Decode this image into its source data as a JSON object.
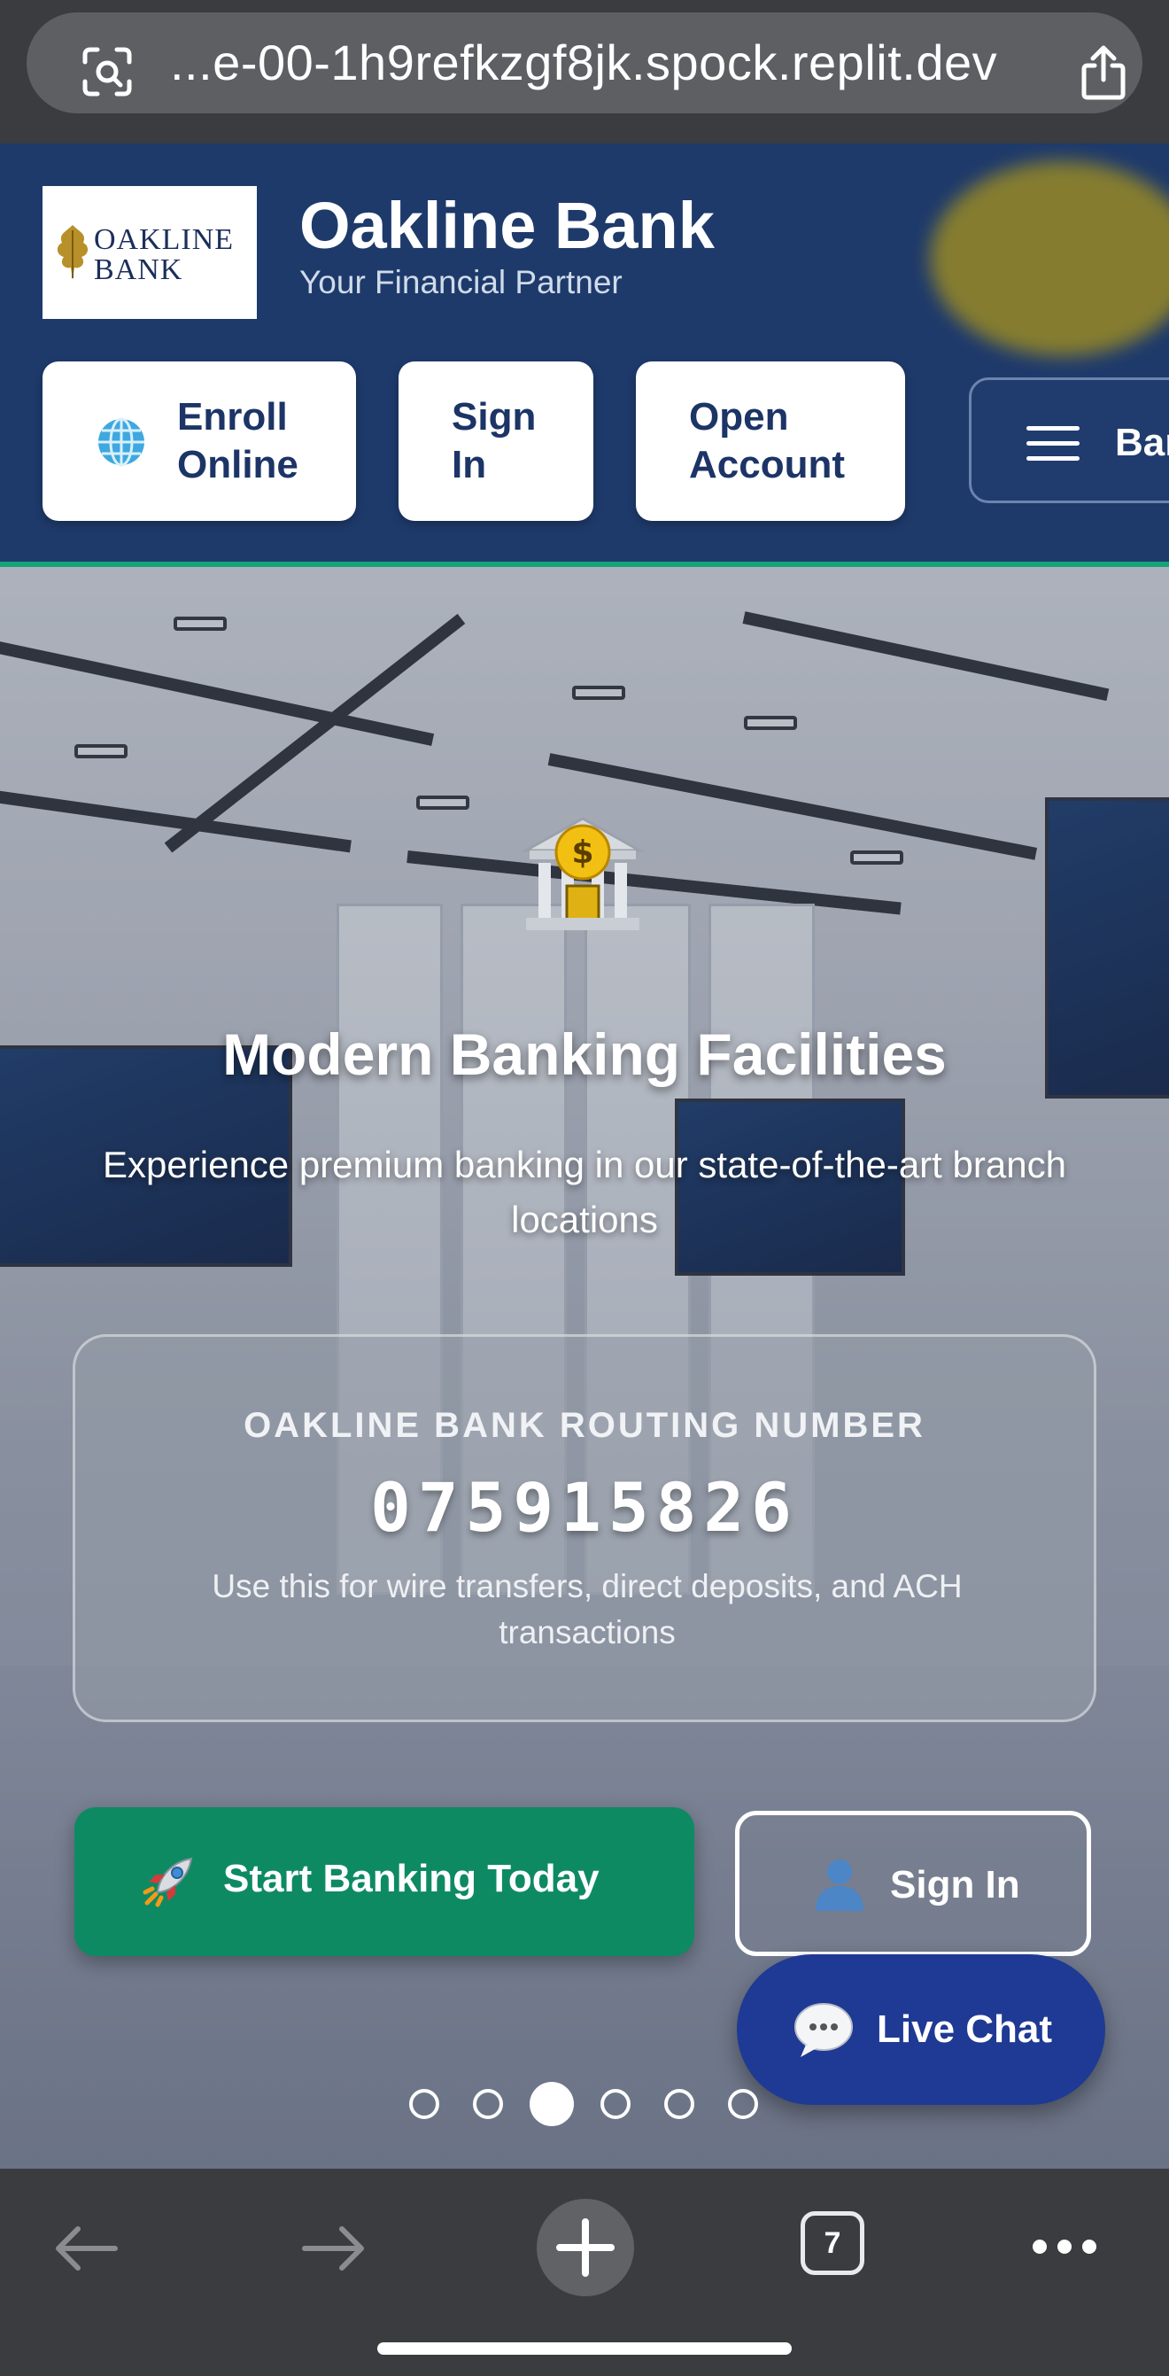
{
  "browser": {
    "url": "...e-00-1h9refkzgf8jk.spock.replit.dev",
    "tab_count": "7"
  },
  "header": {
    "logo_line1": "OAKLINE",
    "logo_line2": "BANK",
    "brand_name": "Oakline Bank",
    "tagline": "Your Financial Partner",
    "enroll_label_1": "Enroll",
    "enroll_label_2": "Online",
    "signin_label_1": "Sign",
    "signin_label_2": "In",
    "open_label_1": "Open",
    "open_label_2": "Account",
    "menu_label": "Bar"
  },
  "hero": {
    "title": "Modern Banking Facilities",
    "subtitle": "Experience premium banking in our state-of-the-art branch locations",
    "routing_label": "OAKLINE BANK ROUTING NUMBER",
    "routing_number": "075915826",
    "routing_note": "Use this for wire transfers, direct deposits, and ACH transactions",
    "cta_start": "Start Banking Today",
    "cta_signin": "Sign In",
    "live_chat": "Live Chat",
    "slides_total": 6,
    "active_slide": 3
  },
  "colors": {
    "header_bg": "#1e3a6b",
    "accent_green": "#0e8a63",
    "chat_blue": "#1f3a94",
    "browser_chrome": "#3a3c40"
  }
}
